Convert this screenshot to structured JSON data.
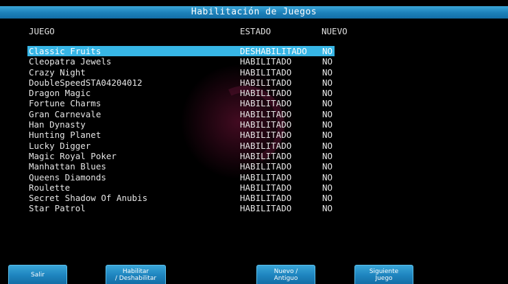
{
  "title": "Habilitación de Juegos",
  "columns": {
    "juego": "JUEGO",
    "estado": "ESTADO",
    "nuevo": "NUEVO"
  },
  "games": [
    {
      "name": "Classic Fruits",
      "estado": "DESHABILITADO",
      "nuevo": "NO",
      "selected": true
    },
    {
      "name": "Cleopatra Jewels",
      "estado": "HABILITADO",
      "nuevo": "NO"
    },
    {
      "name": "Crazy Night",
      "estado": "HABILITADO",
      "nuevo": "NO"
    },
    {
      "name": "DoubleSpeedSTA04204012",
      "estado": "HABILITADO",
      "nuevo": "NO"
    },
    {
      "name": "Dragon Magic",
      "estado": "HABILITADO",
      "nuevo": "NO"
    },
    {
      "name": "Fortune Charms",
      "estado": "HABILITADO",
      "nuevo": "NO"
    },
    {
      "name": "Gran Carnevale",
      "estado": "HABILITADO",
      "nuevo": "NO"
    },
    {
      "name": "Han Dynasty",
      "estado": "HABILITADO",
      "nuevo": "NO"
    },
    {
      "name": "Hunting Planet",
      "estado": "HABILITADO",
      "nuevo": "NO"
    },
    {
      "name": "Lucky Digger",
      "estado": "HABILITADO",
      "nuevo": "NO"
    },
    {
      "name": "Magic Royal Poker",
      "estado": "HABILITADO",
      "nuevo": "NO"
    },
    {
      "name": "Manhattan Blues",
      "estado": "HABILITADO",
      "nuevo": "NO"
    },
    {
      "name": "Queens Diamonds",
      "estado": "HABILITADO",
      "nuevo": "NO"
    },
    {
      "name": "Roulette",
      "estado": "HABILITADO",
      "nuevo": "NO"
    },
    {
      "name": "Secret Shadow Of Anubis",
      "estado": "HABILITADO",
      "nuevo": "NO"
    },
    {
      "name": "Star Patrol",
      "estado": "HABILITADO",
      "nuevo": "NO"
    }
  ],
  "buttons": {
    "salir": {
      "line1": "Salir",
      "line2": ""
    },
    "habilitar": {
      "line1": "Habilitar",
      "line2": "/ Deshabilitar"
    },
    "nuevo": {
      "line1": "Nuevo /",
      "line2": "Antiguo"
    },
    "siguiente": {
      "line1": "Siguiente",
      "line2": "Juego"
    }
  },
  "colors": {
    "accent": "#1c7fb8",
    "selection": "#37b6e6",
    "background": "#000000"
  }
}
